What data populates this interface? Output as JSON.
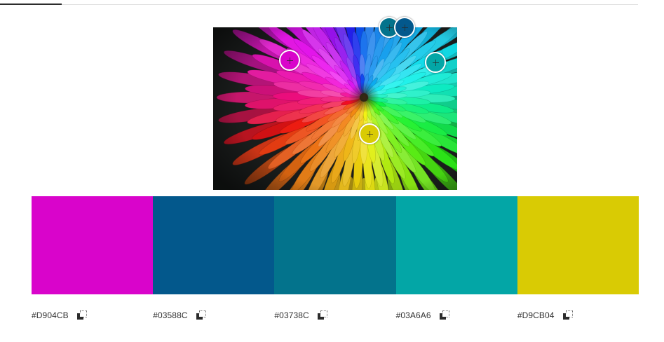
{
  "tabs": {
    "active_indicator": "#2c2c2c"
  },
  "photo": {
    "subject": "rainbow chrysanthemum flower"
  },
  "pickers": [
    {
      "name": "picker-magenta",
      "color": "#D904CB"
    },
    {
      "name": "picker-blue",
      "color": "#03588C"
    },
    {
      "name": "picker-teal-dark",
      "color": "#03738C"
    },
    {
      "name": "picker-teal",
      "color": "#03A6A6"
    },
    {
      "name": "picker-yellow",
      "color": "#D9CB04"
    }
  ],
  "palette": [
    {
      "hex": "#D904CB",
      "label": "#D904CB",
      "copy_icon": "copy-icon"
    },
    {
      "hex": "#03588C",
      "label": "#03588C",
      "copy_icon": "copy-icon"
    },
    {
      "hex": "#03738C",
      "label": "#03738C",
      "copy_icon": "copy-icon"
    },
    {
      "hex": "#03A6A6",
      "label": "#03A6A6",
      "copy_icon": "copy-icon"
    },
    {
      "hex": "#D9CB04",
      "label": "#D9CB04",
      "copy_icon": "copy-icon"
    }
  ]
}
